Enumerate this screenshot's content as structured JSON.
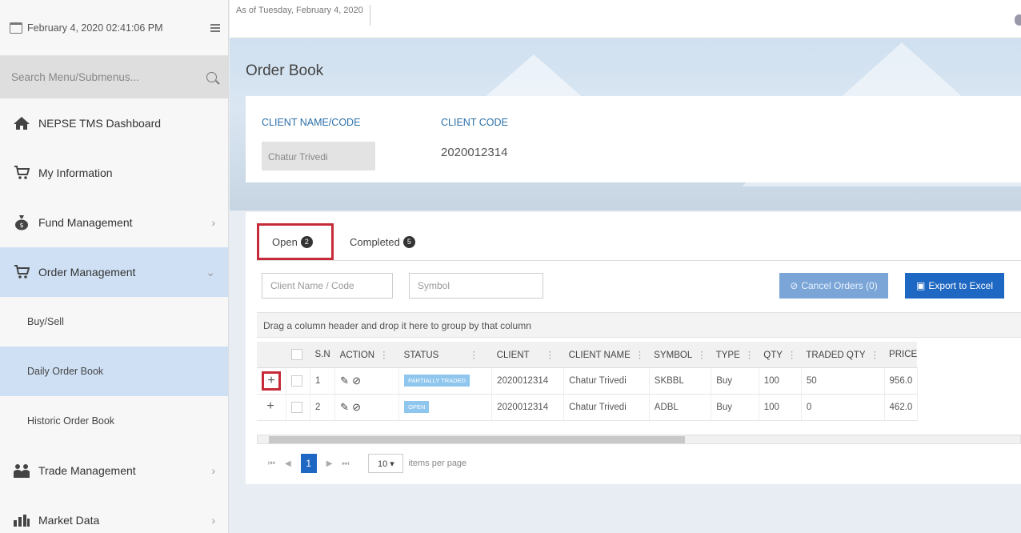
{
  "sidebar": {
    "datetime": "February 4, 2020 02:41:06 PM",
    "search_placeholder": "Search Menu/Submenus...",
    "items": [
      {
        "label": "NEPSE TMS Dashboard",
        "icon": "home-icon"
      },
      {
        "label": "My Information",
        "icon": "cart-icon"
      },
      {
        "label": "Fund Management",
        "icon": "money-bag-icon",
        "chevron": "›"
      },
      {
        "label": "Order Management",
        "icon": "cart-icon",
        "chevron": "⌄",
        "active": true
      },
      {
        "label": "Trade Management",
        "icon": "people-icon",
        "chevron": "›"
      },
      {
        "label": "Market Data",
        "icon": "chart-icon",
        "chevron": "›"
      }
    ],
    "sub_items": [
      {
        "label": "Buy/Sell"
      },
      {
        "label": "Daily Order Book",
        "active": true
      },
      {
        "label": "Historic Order Book"
      }
    ]
  },
  "topbar": {
    "as_of": "As of Tuesday, February 4, 2020"
  },
  "page": {
    "title": "Order Book"
  },
  "client": {
    "name_label": "CLIENT NAME/CODE",
    "code_label": "CLIENT CODE",
    "name_value": "Chatur Trivedi",
    "code_value": "2020012314"
  },
  "tabs": [
    {
      "label": "Open",
      "count": "2"
    },
    {
      "label": "Completed",
      "count": "5"
    }
  ],
  "filters": {
    "client_placeholder": "Client Name / Code",
    "symbol_placeholder": "Symbol"
  },
  "buttons": {
    "cancel": "Cancel Orders (0)",
    "export": "Export to Excel"
  },
  "group_hint": "Drag a column header and drop it here to group by that column",
  "table": {
    "headers": [
      "S.N",
      "ACTION",
      "STATUS",
      "CLIENT",
      "CLIENT NAME",
      "SYMBOL",
      "TYPE",
      "QTY",
      "TRADED QTY",
      "PRICE"
    ],
    "rows": [
      {
        "sn": "1",
        "status": "PARTIALLY TRADED",
        "client": "2020012314",
        "name": "Chatur Trivedi",
        "symbol": "SKBBL",
        "type": "Buy",
        "qty": "100",
        "traded": "50",
        "price": "956.0"
      },
      {
        "sn": "2",
        "status": "OPEN",
        "client": "2020012314",
        "name": "Chatur Trivedi",
        "symbol": "ADBL",
        "type": "Buy",
        "qty": "100",
        "traded": "0",
        "price": "462.0"
      }
    ]
  },
  "pager": {
    "current": "1",
    "page_size": "10 ▾",
    "items_per_page": "items per page"
  },
  "colors": {
    "accent": "#1e67c2",
    "highlight": "#c62b3a",
    "active_bg": "#cfe0f5"
  }
}
